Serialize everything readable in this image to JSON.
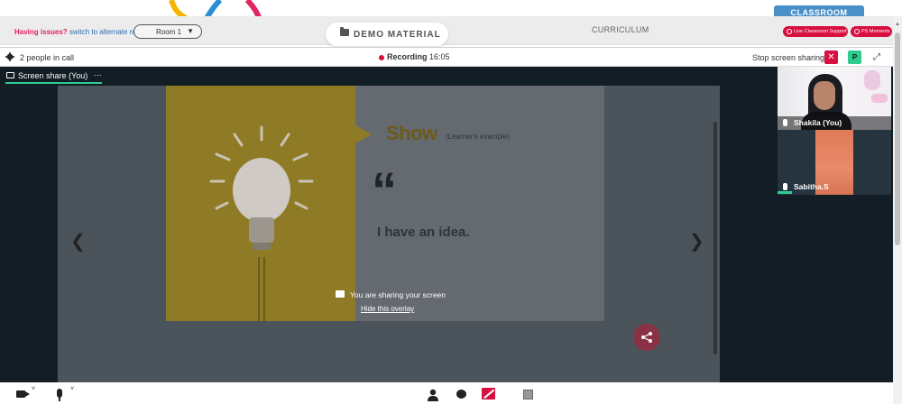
{
  "topbar": {
    "issues_text": "Having issues?",
    "alternate_link": "switch to alternate room",
    "room_value": "Room 1",
    "demo_material_label": "DEMO MATERIAL",
    "curriculum_label": "CURRICULUM",
    "classroom_tab": "CLASSROOM",
    "live_support_label": "Live Classroom Support",
    "ps_moments_label": "PS Moments"
  },
  "callbar": {
    "people_count": "2 people in call",
    "recording_label": "Recording",
    "recording_time": "16:05",
    "stop_share_label": "Stop screen sharing",
    "close_glyph": "✕",
    "presenter_badge": "P"
  },
  "meeting": {
    "share_tab_label": "Screen share (You)",
    "share_tab_more": "···",
    "overlay_text": "You are sharing your screen",
    "overlay_link": "Hide this overlay",
    "slide": {
      "title": "Show",
      "subtitle": "(Learner's example)",
      "quote_mark": "“",
      "quote_text": "I have an idea."
    }
  },
  "participants": [
    {
      "name": "Shakila (You)"
    },
    {
      "name": "Sabitha.S"
    }
  ],
  "colors": {
    "accent_red": "#d7103f",
    "accent_green": "#2ecc8f",
    "classroom_blue": "#4a90c8",
    "dark_bg": "#121d25"
  }
}
